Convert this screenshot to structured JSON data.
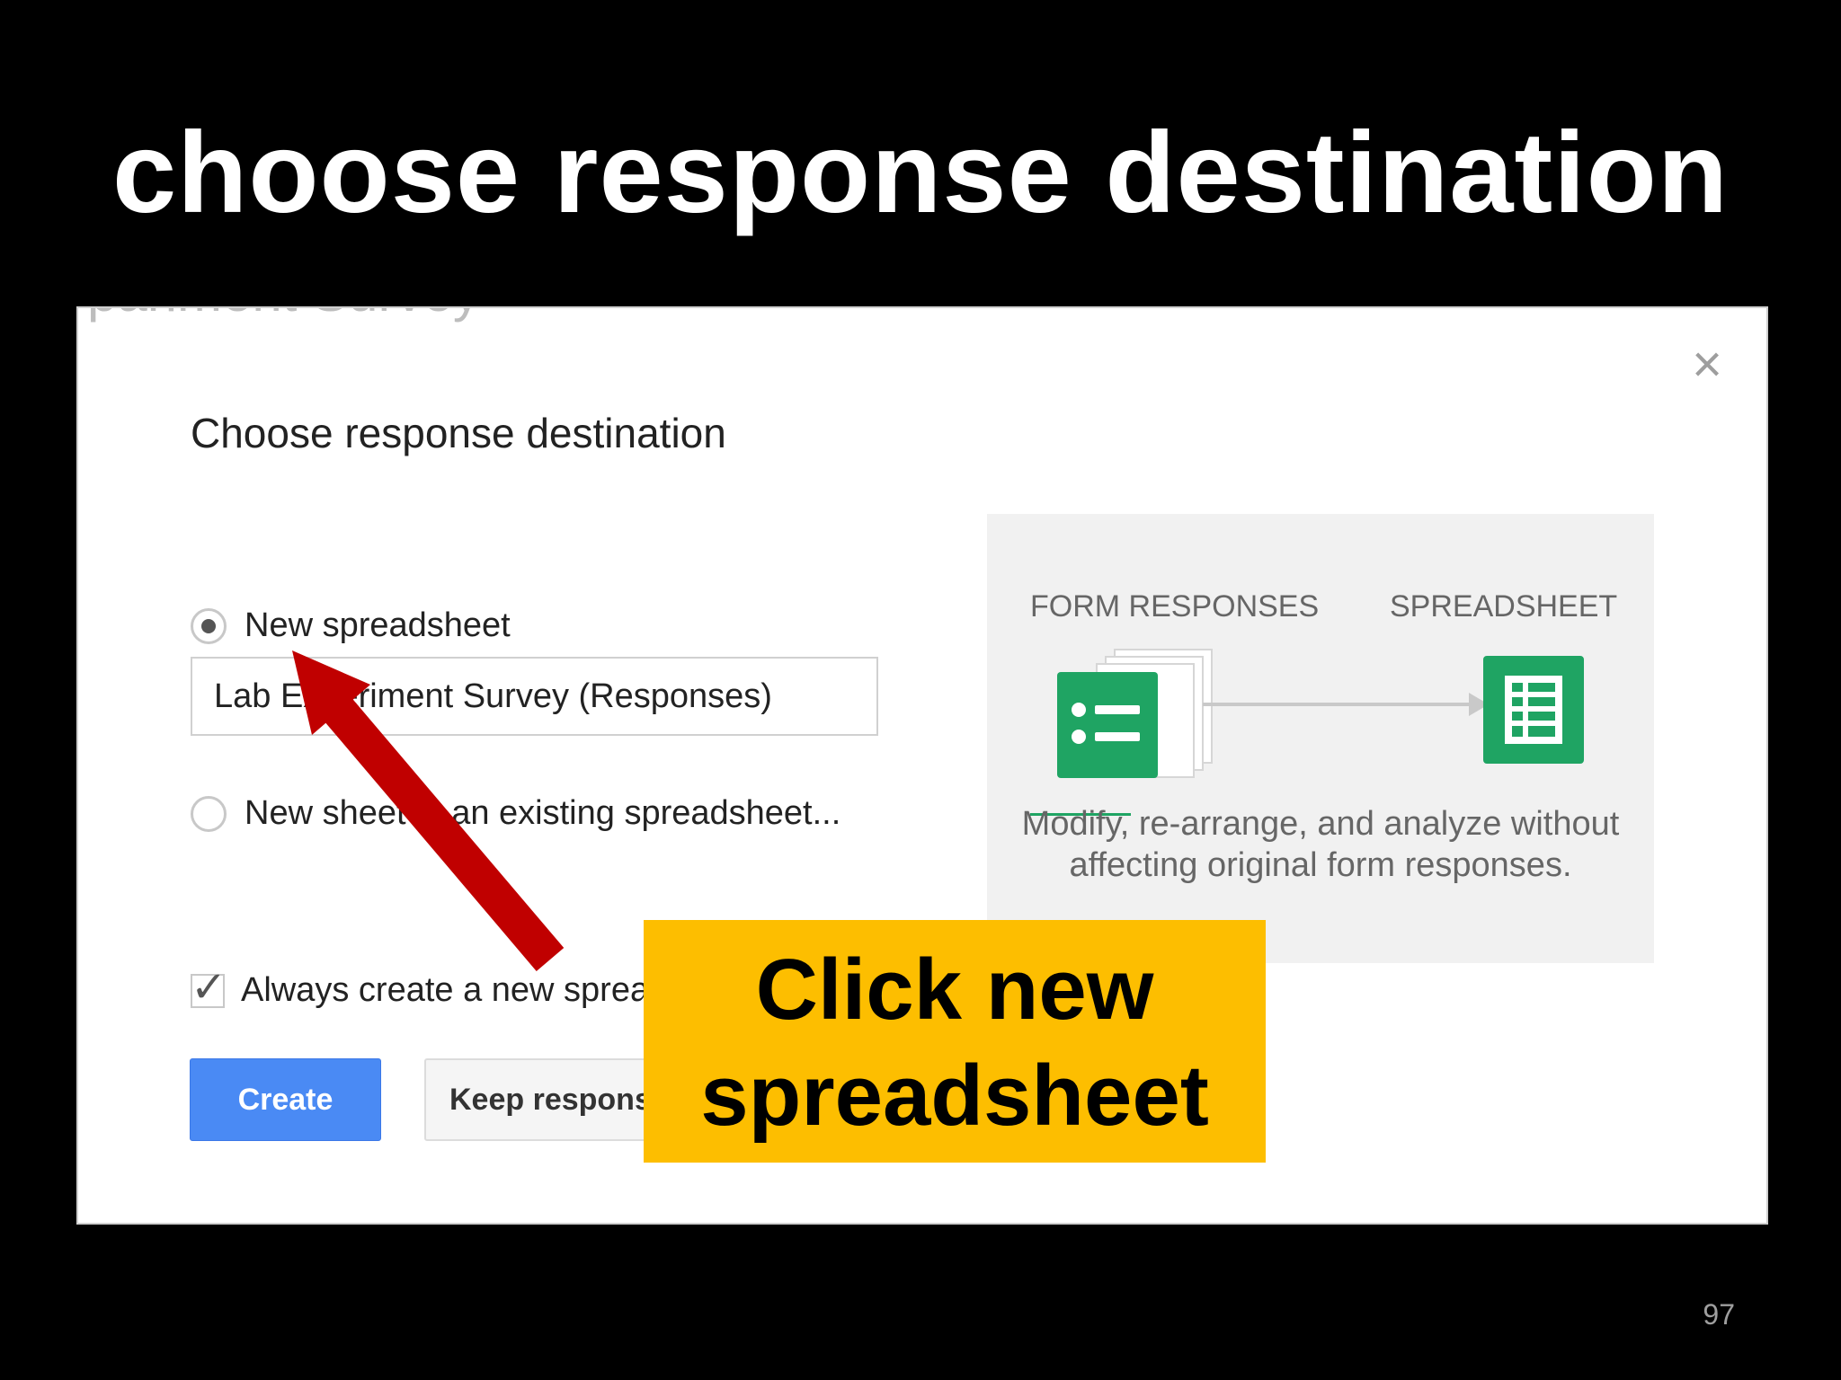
{
  "slide": {
    "title": "choose response destination",
    "page_number": "97"
  },
  "background_fragment": "pariment Survey",
  "dialog": {
    "close_glyph": "×",
    "title": "Choose response destination",
    "options": [
      {
        "label": "New spreadsheet",
        "selected": true
      },
      {
        "label": "New sheet in an existing spreadsheet...",
        "selected": false
      }
    ],
    "spreadsheet_name_value": "Lab Experiment Survey (Responses)",
    "always_create_label": "Always create a new spreadsheet",
    "always_create_checked": true,
    "create_button": "Create",
    "keep_button": "Keep responses only in Forms"
  },
  "panel": {
    "label_left": "FORM RESPONSES",
    "label_right": "SPREADSHEET",
    "description_line1": "Modify, re-arrange, and analyze without",
    "description_line2": "affecting original form responses.",
    "forms_icon": "google-forms-icon",
    "sheets_icon": "google-sheets-icon",
    "green_color": "#1fa463"
  },
  "callout": {
    "line1": "Click new",
    "line2": "spreadsheet",
    "color": "#fdbe00"
  },
  "arrow_color": "#c00000"
}
